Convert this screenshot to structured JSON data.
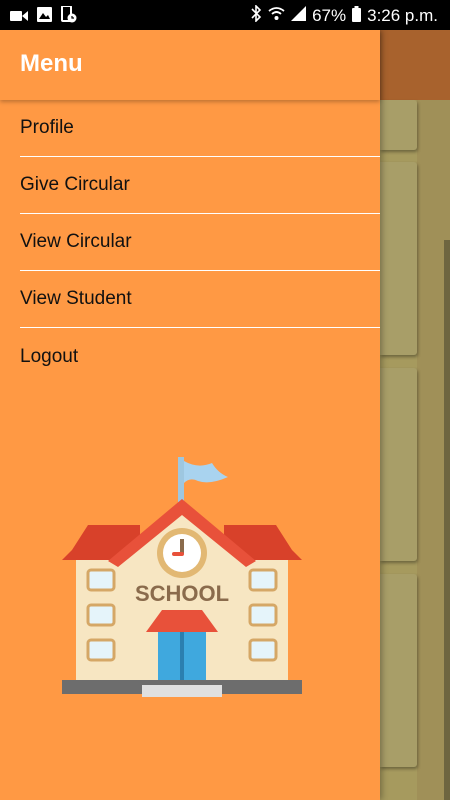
{
  "status_bar": {
    "battery": "67%",
    "time": "3:26 p.m."
  },
  "drawer": {
    "title": "Menu",
    "items": [
      {
        "label": "Profile"
      },
      {
        "label": "Give Circular"
      },
      {
        "label": "View Circular"
      },
      {
        "label": "View Student"
      }
    ],
    "logout_label": "Logout"
  },
  "illustration": {
    "sign_text": "SCHOOL"
  },
  "colors": {
    "drawer_bg": "#ff9944",
    "background_appbar": "#a8622d",
    "background_card": "#a89e68"
  }
}
